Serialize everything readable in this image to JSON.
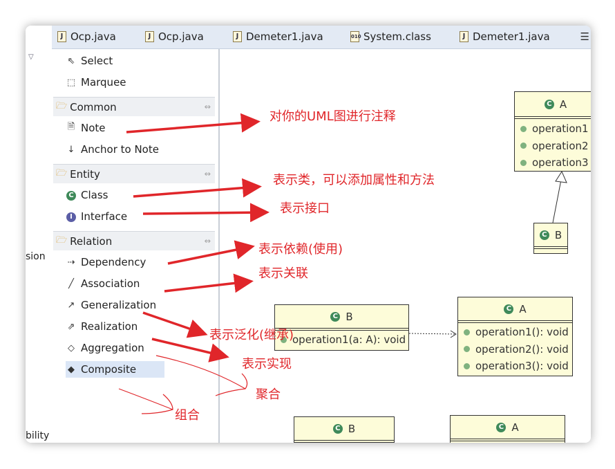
{
  "left_fragments": [
    "sion",
    "bility"
  ],
  "tabs": [
    {
      "label": "Ocp.java",
      "icon": "java-file-icon"
    },
    {
      "label": "Ocp.java",
      "icon": "java-file-icon"
    },
    {
      "label": "Demeter1.java",
      "icon": "java-file-icon"
    },
    {
      "label": "System.class",
      "icon": "class-file-icon"
    },
    {
      "label": "Demeter1.java",
      "icon": "java-file-icon"
    }
  ],
  "palette": {
    "tools": [
      {
        "label": "Select"
      },
      {
        "label": "Marquee"
      }
    ],
    "common": {
      "title": "Common",
      "items": [
        {
          "label": "Note"
        },
        {
          "label": "Anchor to Note"
        }
      ]
    },
    "entity": {
      "title": "Entity",
      "items": [
        {
          "label": "Class"
        },
        {
          "label": "Interface"
        }
      ]
    },
    "relation": {
      "title": "Relation",
      "items": [
        {
          "label": "Dependency"
        },
        {
          "label": "Association"
        },
        {
          "label": "Generalization"
        },
        {
          "label": "Realization"
        },
        {
          "label": "Aggregation"
        },
        {
          "label": "Composite"
        }
      ]
    },
    "selected": "Composite"
  },
  "diagram": {
    "top_a": {
      "name": "A",
      "ops": [
        "operation1",
        "operation2",
        "operation3"
      ]
    },
    "top_b": {
      "name": "B"
    },
    "mid_b": {
      "name": "B",
      "ops": [
        "operation1(a: A): void"
      ]
    },
    "mid_a": {
      "name": "A",
      "ops": [
        "operation1(): void",
        "operation2(): void",
        "operation3(): void"
      ]
    },
    "bot_b": {
      "name": "B"
    },
    "bot_a": {
      "name": "A"
    }
  },
  "annotations": {
    "note": "对你的UML图进行注释",
    "class": "表示类，可以添加属性和方法",
    "interface": "表示接口",
    "dependency": "表示依赖(使用)",
    "association": "表示关联",
    "generalization": "表示泛化(继承)",
    "realization": "表示实现",
    "aggregation": "聚合",
    "composite": "组合"
  },
  "colors": {
    "annotation": "#e0262a",
    "class_fill": "#fdfcd9",
    "tabbar": "#e3eaf4"
  }
}
